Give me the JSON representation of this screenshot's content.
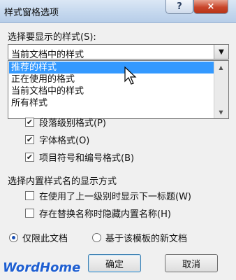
{
  "window": {
    "title": "样式窗格选项"
  },
  "titlebar": {
    "help_label": "?",
    "close_label": "×"
  },
  "style_select": {
    "label": "选择要显示的样式(S):",
    "value": "当前文档中的样式",
    "options": [
      "推荐的样式",
      "正在使用的格式",
      "当前文档中的样式",
      "所有样式"
    ],
    "highlighted": "推荐的样式"
  },
  "format_checks": [
    {
      "label": "段落级别格式(P)",
      "checked": true
    },
    {
      "label": "字体格式(O)",
      "checked": true
    },
    {
      "label": "项目符号和编号格式(B)",
      "checked": true
    }
  ],
  "builtin_names": {
    "heading": "选择内置样式名的显示方式",
    "options": [
      {
        "label": "在使用了上一级别时显示下一标题(W)",
        "checked": false
      },
      {
        "label": "存在替换名称时隐藏内置名称(H)",
        "checked": false
      }
    ]
  },
  "scope": {
    "this_document": "仅限此文档",
    "new_documents": "基于该模板的新文档",
    "selected": "this_document"
  },
  "buttons": {
    "ok": "确定",
    "cancel": "取消"
  },
  "watermark": "WordHome"
}
